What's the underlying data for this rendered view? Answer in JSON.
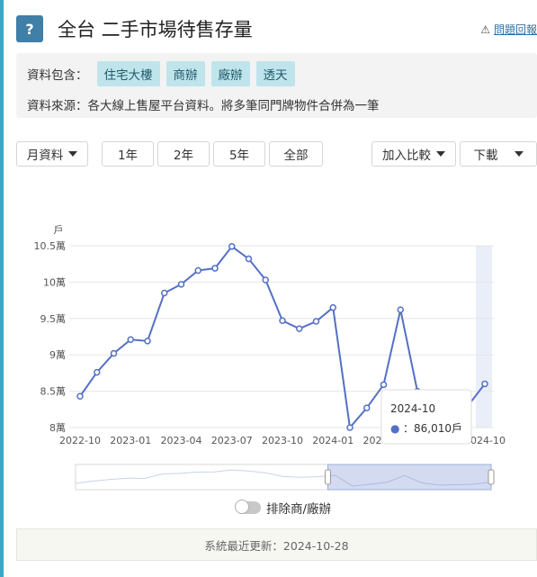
{
  "header": {
    "badge": "?",
    "title": "全台 二手市場待售存量",
    "report_label": "問題回報"
  },
  "info": {
    "include_label": "資料包含：",
    "tags": [
      "住宅大樓",
      "商辦",
      "廠辦",
      "透天"
    ],
    "source_text": "資料來源：各大線上售屋平台資料。將多筆同門牌物件合併為一筆"
  },
  "controls": {
    "period_select": "月資料",
    "ranges": [
      "1年",
      "2年",
      "5年",
      "全部"
    ],
    "compare": "加入比較",
    "download": "下載"
  },
  "chart_data": {
    "type": "line",
    "y_unit": "戶",
    "ylim": [
      80000,
      105000
    ],
    "y_ticks": [
      80000,
      85000,
      90000,
      95000,
      100000,
      105000
    ],
    "y_tick_labels": [
      "8萬",
      "8.5萬",
      "9萬",
      "9.5萬",
      "10萬",
      "10.5萬"
    ],
    "x": [
      "2022-10",
      "2022-11",
      "2022-12",
      "2023-01",
      "2023-02",
      "2023-03",
      "2023-04",
      "2023-05",
      "2023-06",
      "2023-07",
      "2023-08",
      "2023-09",
      "2023-10",
      "2023-11",
      "2023-12",
      "2024-01",
      "2024-02",
      "2024-03",
      "2024-04",
      "2024-05",
      "2024-06",
      "2024-07",
      "2024-08",
      "2024-09",
      "2024-10"
    ],
    "x_tick_labels": [
      "2022-10",
      "2023-01",
      "2023-04",
      "2023-07",
      "2023-10",
      "2024-01",
      "2024-04",
      "2024-07",
      "2024-10"
    ],
    "series": [
      {
        "values": [
          84300,
          87600,
          90200,
          92100,
          91900,
          98500,
          99700,
          101600,
          101900,
          104900,
          103200,
          100300,
          94700,
          93600,
          94600,
          96500,
          80000,
          82700,
          85900,
          96200,
          85000,
          81500,
          82000,
          83000,
          86010
        ]
      }
    ],
    "grid": true,
    "highlighted_point": "2024-10",
    "tooltip": {
      "title": "2024-10",
      "marker": "●",
      "value_text": "：86,010戶"
    },
    "colors": {
      "line": "#5470c6",
      "highlight_band": "#e9eef8",
      "grid": "#e6e6e6"
    }
  },
  "toggle": {
    "label": "排除商/廠辦",
    "on": false
  },
  "footer": {
    "text": "系統最近更新：2024-10-28"
  }
}
